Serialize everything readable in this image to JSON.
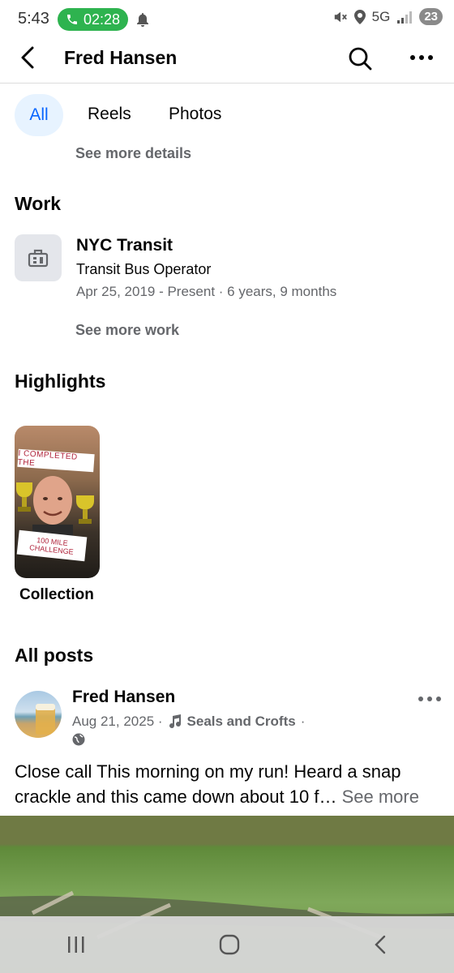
{
  "status_bar": {
    "time": "5:43",
    "call_timer": "02:28",
    "network": "5G",
    "battery": "23"
  },
  "header": {
    "title": "Fred Hansen"
  },
  "tabs": [
    {
      "label": "All"
    },
    {
      "label": "Reels"
    },
    {
      "label": "Photos"
    }
  ],
  "details": {
    "see_more_details": "See more details"
  },
  "work": {
    "heading": "Work",
    "company": "NYC Transit",
    "position": "Transit Bus Operator",
    "dates": "Apr 25, 2019 - Present · 6 years, 9 months",
    "see_more_work": "See more work"
  },
  "highlights": {
    "heading": "Highlights",
    "card_text_top": "I COMPLETED THE",
    "card_text_bottom": "100 MILE CHALLENGE",
    "label": "Collection"
  },
  "posts": {
    "heading": "All posts",
    "author": "Fred Hansen",
    "date": "Aug 21, 2025 ·",
    "music": "Seals and Crofts",
    "music_sep": "·",
    "text": "Close call This morning on my run! Heard a snap crackle and this came down about 10 f…",
    "see_more": "See more"
  },
  "colors": {
    "accent": "#0866ff",
    "tab_active_bg": "#e7f3ff",
    "call_green": "#2eb34f",
    "secondary_text": "#65676b"
  }
}
